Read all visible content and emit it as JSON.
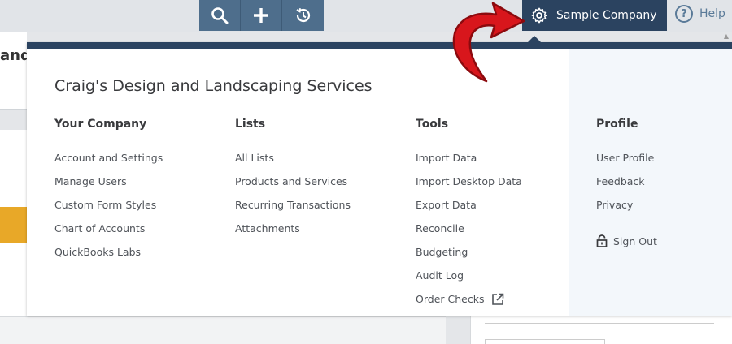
{
  "topbar": {
    "tools": [
      {
        "name": "search",
        "icon": "search-icon"
      },
      {
        "name": "create",
        "icon": "plus-icon"
      },
      {
        "name": "recent",
        "icon": "history-icon"
      }
    ],
    "company_label": "Sample Company",
    "help_label": "Help"
  },
  "background": {
    "partial_title": "and"
  },
  "menu": {
    "title": "Craig's Design and Landscaping Services",
    "columns": {
      "your_company": {
        "heading": "Your Company",
        "items": [
          "Account and Settings",
          "Manage Users",
          "Custom Form Styles",
          "Chart of Accounts",
          "QuickBooks Labs"
        ]
      },
      "lists": {
        "heading": "Lists",
        "items": [
          "All Lists",
          "Products and Services",
          "Recurring Transactions",
          "Attachments"
        ]
      },
      "tools": {
        "heading": "Tools",
        "items": [
          "Import Data",
          "Import Desktop Data",
          "Export Data",
          "Reconcile",
          "Budgeting",
          "Audit Log",
          "Order Checks"
        ]
      },
      "profile": {
        "heading": "Profile",
        "items": [
          "User Profile",
          "Feedback",
          "Privacy"
        ]
      }
    },
    "sign_out": "Sign Out"
  },
  "colors": {
    "header_navy": "#2b4360",
    "tool_blue": "#4e6e8c",
    "profile_bg": "#f3f7fb",
    "annotation_red": "#d8161c"
  }
}
